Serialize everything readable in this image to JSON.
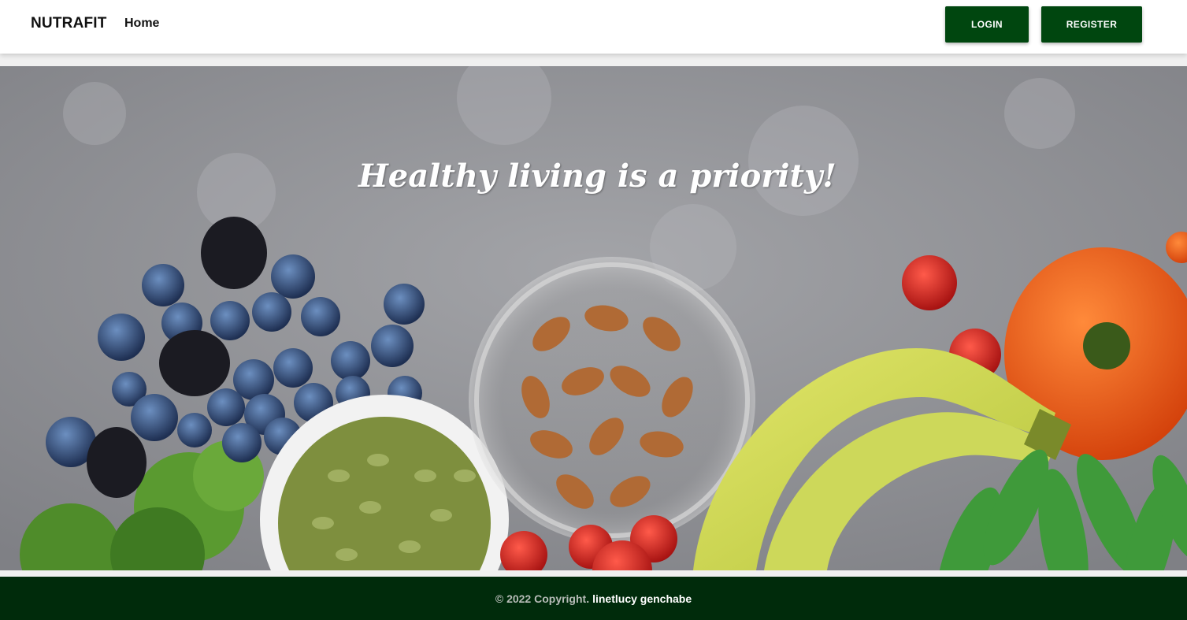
{
  "navbar": {
    "brand": "NUTRAFIT",
    "home_label": "Home",
    "login_label": "LOGIN",
    "register_label": "REGISTER"
  },
  "hero": {
    "title": "Healthy living is a priority!"
  },
  "footer": {
    "copyright": "© 2022 Copyright.",
    "author": "linetlucy genchabe"
  },
  "colors": {
    "primary_button": "#00460f",
    "footer_bg": "#002b0b",
    "hero_bg": "#8e8f93"
  }
}
